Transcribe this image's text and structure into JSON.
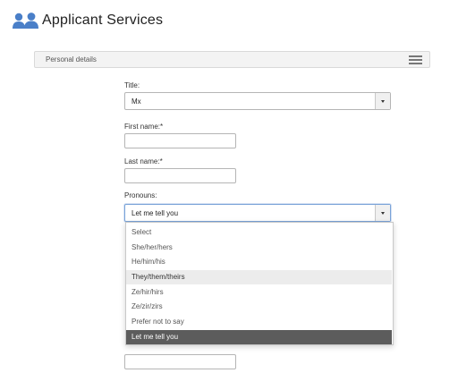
{
  "header": {
    "app_title": "Applicant Services",
    "logo_icon": "people-icon"
  },
  "section": {
    "title": "Personal details",
    "menu_icon": "hamburger-icon"
  },
  "form": {
    "title_label": "Title:",
    "title_value": "Mx",
    "first_name_label": "First name:*",
    "first_name_value": "",
    "last_name_label": "Last name:*",
    "last_name_value": "",
    "pronouns_label": "Pronouns:",
    "pronouns_value": "Let me tell you",
    "pronoun_options": [
      "Select",
      "She/her/hers",
      "He/him/his",
      "They/them/theirs",
      "Ze/hir/hirs",
      "Ze/zir/zirs",
      "Prefer not to say",
      "Let me tell you"
    ],
    "custom_pronoun_value": ""
  },
  "colors": {
    "logo": "#4a7fc8",
    "selected_option": "#5c5c5c",
    "focus_border": "#7aa3d8"
  }
}
